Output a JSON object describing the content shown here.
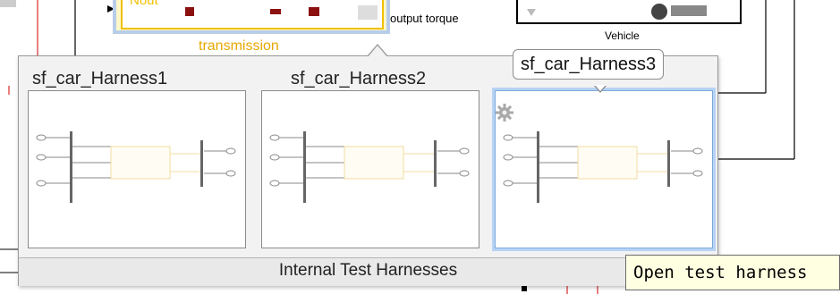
{
  "canvas": {
    "nout_label": "Nout",
    "output_torque_label": "output torque",
    "transmission_label": "transmission",
    "vehicle_label": "Vehicle"
  },
  "popup": {
    "harnesses": [
      {
        "name": "sf_car_Harness1",
        "selected": false
      },
      {
        "name": "sf_car_Harness2",
        "selected": false
      },
      {
        "name": "sf_car_Harness3",
        "selected": true
      }
    ],
    "footer_label": "Internal Test Harnesses"
  },
  "tooltips": {
    "harness_name": "sf_car_Harness3",
    "hover": "Open test harness"
  },
  "colors": {
    "accent_selected": "#7fa9dc",
    "transmission": "#e8a800",
    "signal_line_red": "#d40000",
    "tooltip_bg": "#ffffe1"
  }
}
